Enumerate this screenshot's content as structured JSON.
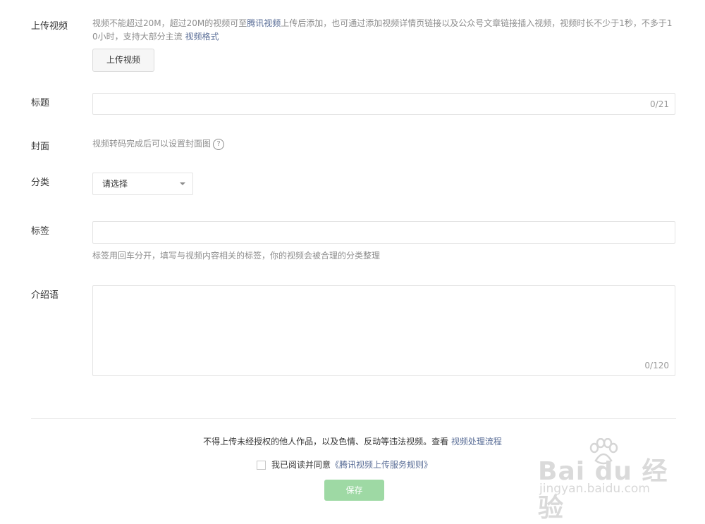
{
  "upload": {
    "label": "上传视频",
    "hint_part1": "视频不能超过20M，超过20M的视频可至",
    "hint_link1": "腾讯视频",
    "hint_part2": "上传后添加，也可通过添加视频详情页链接以及公众号文章链接插入视频，视频时长不少于1秒，不多于1",
    "hint_part3": "0小时，支持大部分主流 ",
    "hint_link2": "视频格式",
    "button_label": "上传视频"
  },
  "title_field": {
    "label": "标题",
    "value": "",
    "counter": "0/21"
  },
  "cover": {
    "label": "封面",
    "hint": "视频转码完成后可以设置封面图",
    "help_glyph": "?"
  },
  "category": {
    "label": "分类",
    "selected": "请选择"
  },
  "tags": {
    "label": "标签",
    "value": "",
    "hint": "标签用回车分开，填写与视频内容相关的标签，你的视频会被合理的分类整理"
  },
  "intro": {
    "label": "介绍语",
    "value": "",
    "counter": "0/120"
  },
  "footer": {
    "notice": "不得上传未经授权的他人作品，以及色情、反动等违法视频。查看 ",
    "notice_link": "视频处理流程",
    "agree_text": "我已阅读并同意",
    "agree_link": "《腾讯视频上传服务规则》",
    "save_label": "保存"
  },
  "watermark": {
    "brand": "Bai du 经验",
    "url": "jingyan.baidu.com"
  },
  "colors": {
    "link": "#576b95",
    "save_button": "#9ed9a4",
    "hint_text": "#8d8d8d"
  }
}
